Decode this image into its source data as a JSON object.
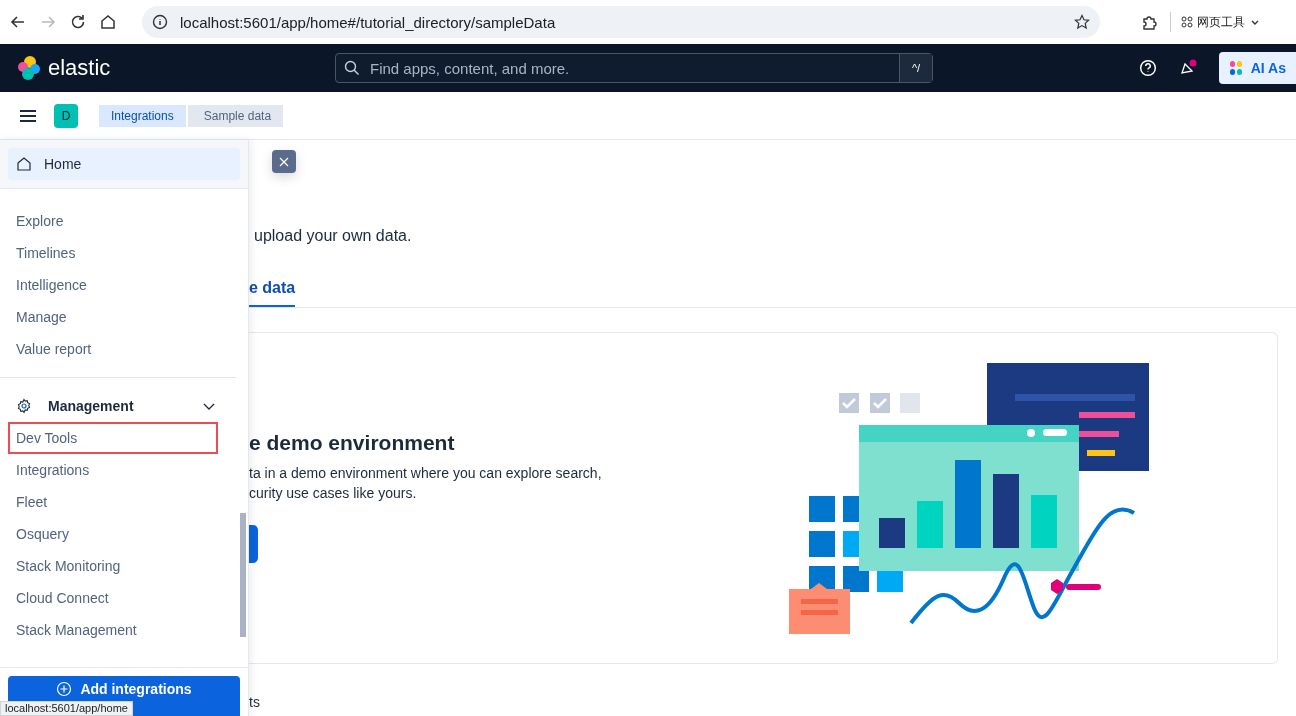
{
  "browser": {
    "url": "localhost:5601/app/home#/tutorial_directory/sampleData",
    "forward_disabled": true,
    "extension_label": "网页工具"
  },
  "header": {
    "brand": "elastic",
    "search": {
      "placeholder": "Find apps, content, and more."
    },
    "shortcut": "^/",
    "news_unread": true,
    "ai_button": "AI As"
  },
  "breadcrumb_bar": {
    "space": "D",
    "crumbs": [
      {
        "label": "Integrations",
        "selected": false
      },
      {
        "label": "Sample data",
        "selected": true
      }
    ]
  },
  "sidebar": {
    "home": {
      "label": "Home",
      "selected": true
    },
    "items": [
      {
        "label": "Explore"
      },
      {
        "label": "Timelines"
      },
      {
        "label": "Intelligence"
      },
      {
        "label": "Manage"
      },
      {
        "label": "Value report"
      }
    ],
    "group": {
      "label": "Management",
      "expanded": true,
      "items": [
        {
          "label": "Dev Tools",
          "highlighted": true
        },
        {
          "label": "Integrations",
          "highlighted": false
        },
        {
          "label": "Fleet",
          "highlighted": false
        },
        {
          "label": "Osquery",
          "highlighted": false
        },
        {
          "label": "Stack Monitoring",
          "highlighted": false
        },
        {
          "label": "Cloud Connect",
          "highlighted": false
        },
        {
          "label": "Stack Management",
          "highlighted": false
        }
      ]
    },
    "add_button": "Add integrations"
  },
  "main": {
    "intro": "upload your own data.",
    "tab": {
      "label": "e data",
      "selected": true
    },
    "card": {
      "title": "e demo environment",
      "description": [
        "ta in a demo environment where you can explore search,",
        "curity use cases like yours."
      ]
    },
    "footer_text": "ts"
  },
  "status_url": "localhost:5601/app/home"
}
